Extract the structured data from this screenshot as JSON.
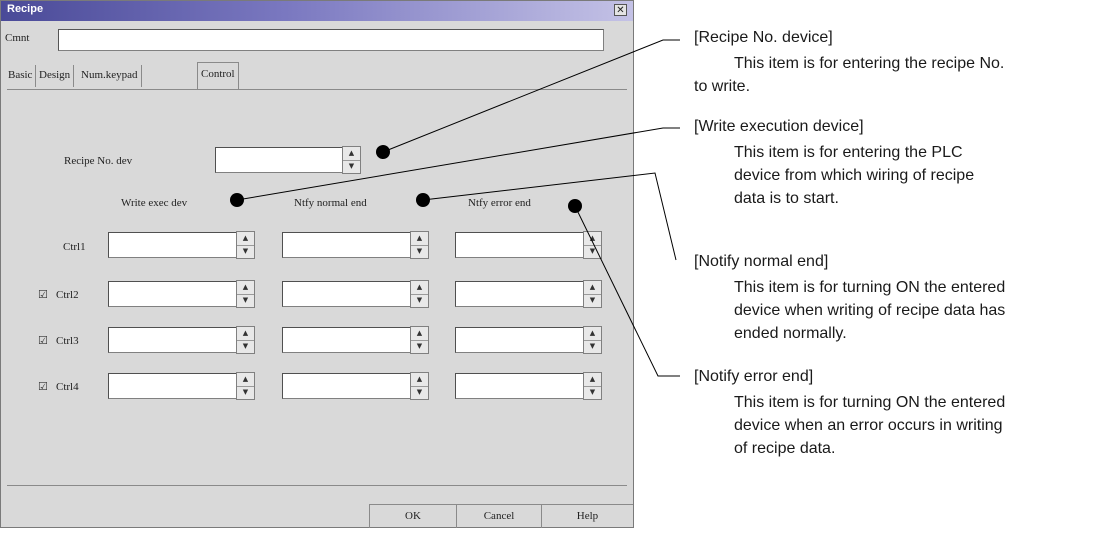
{
  "dialog": {
    "title": "Recipe",
    "close_glyph": "✕",
    "comment_label": "Cmnt",
    "comment_value": "",
    "tabs": [
      {
        "label": "Basic"
      },
      {
        "label": "Design"
      },
      {
        "label": "Num.keypad"
      },
      {
        "label": "Control"
      }
    ],
    "active_tab": "Control",
    "recipe_no_label": "Recipe No. dev",
    "recipe_no_value": "",
    "columns": {
      "write_exec": "Write exec dev",
      "notify_normal": "Ntfy normal end",
      "notify_error": "Ntfy error end"
    },
    "rows": [
      {
        "label": "Ctrl1",
        "checked": false,
        "show_checkbox": false
      },
      {
        "label": "Ctrl2",
        "checked": true,
        "show_checkbox": true
      },
      {
        "label": "Ctrl3",
        "checked": true,
        "show_checkbox": true
      },
      {
        "label": "Ctrl4",
        "checked": true,
        "show_checkbox": true
      }
    ],
    "buttons": {
      "ok": "OK",
      "cancel": "Cancel",
      "help": "Help"
    },
    "spin_up_glyph": "▲",
    "spin_down_glyph": "▼",
    "check_glyph": "☑"
  },
  "notes": {
    "recipe_no": {
      "title": "[Recipe No. device]",
      "body_lines": [
        "This item is for entering the recipe No.",
        "to write."
      ]
    },
    "write_exec": {
      "title": "[Write execution device]",
      "body_lines": [
        "This item is for entering the PLC",
        "device from which wiring of recipe",
        "data is to start."
      ]
    },
    "notify_normal": {
      "title": "[Notify normal end]",
      "body_lines": [
        "This item is for turning ON the entered",
        "device when writing of recipe data has",
        "ended normally."
      ]
    },
    "notify_error": {
      "title": "[Notify error end]",
      "body_lines": [
        "This item is for turning ON the entered",
        "device when an error occurs in writing",
        "of recipe data."
      ]
    }
  },
  "colors": {
    "dialog_bg": "#d9d9d9",
    "title_gradient_start": "#4a4a98",
    "leader_line": "#000000"
  }
}
